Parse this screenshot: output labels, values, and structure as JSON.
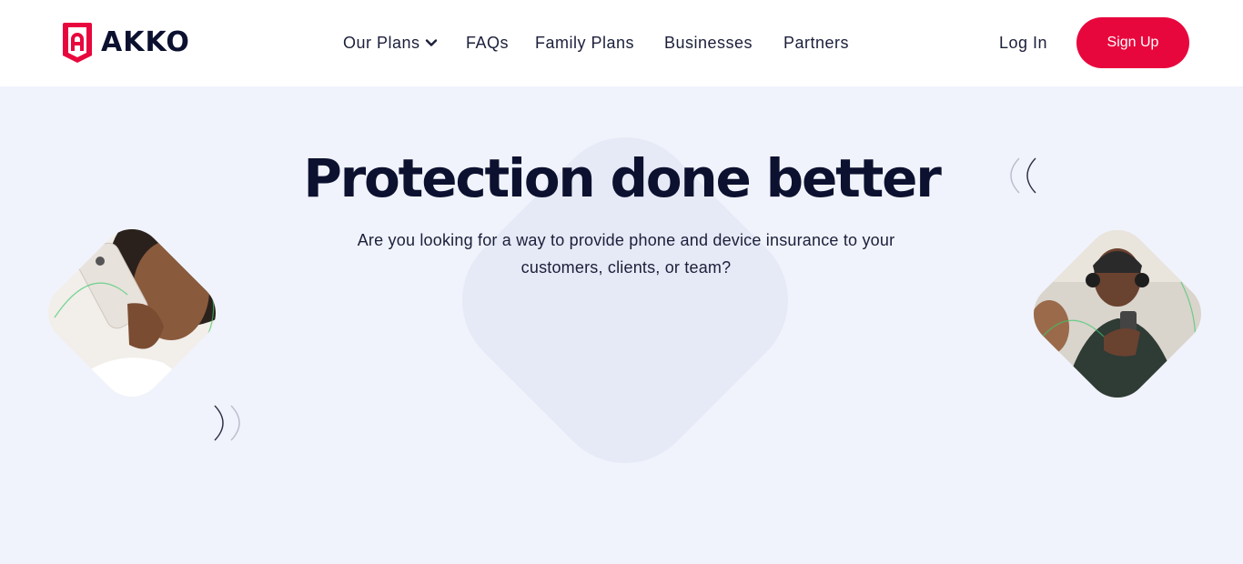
{
  "brand": {
    "name": "AKKO",
    "accent_color": "#e8073d",
    "text_color": "#0d1130"
  },
  "nav": {
    "items": [
      {
        "label": "Our Plans",
        "has_dropdown": true,
        "icon": "chevron-down-icon"
      },
      {
        "label": "FAQs"
      },
      {
        "label": "Family Plans"
      },
      {
        "label": "Businesses"
      },
      {
        "label": "Partners"
      }
    ],
    "login_label": "Log In",
    "signup_label": "Sign Up"
  },
  "hero": {
    "title": "Protection done better",
    "subtitle": "Are you looking for a way to provide phone and device insurance to your customers, clients, or team?",
    "background_color": "#f0f3fb",
    "left_image": "woman-on-phone-photo",
    "right_image": "man-with-headphones-on-train-photo",
    "decorations": [
      "double-chevron-right-icon",
      "double-chevron-left-icon"
    ]
  }
}
